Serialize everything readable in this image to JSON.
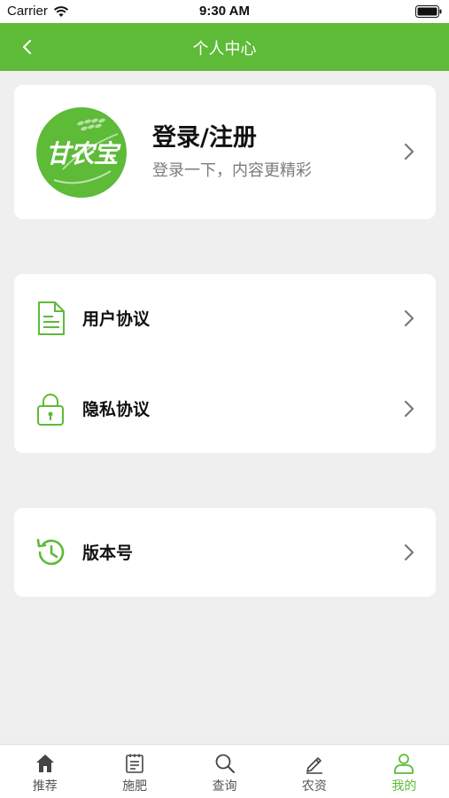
{
  "status_bar": {
    "carrier": "Carrier",
    "time": "9:30 AM"
  },
  "nav_bar": {
    "title": "个人中心"
  },
  "profile": {
    "logo_text": "甘农宝",
    "name": "登录/注册",
    "subtitle": "登录一下，内容更精彩"
  },
  "menu": {
    "user_agreement": "用户协议",
    "privacy_agreement": "隐私协议",
    "version": "版本号"
  },
  "tabs": [
    {
      "label": "推荐",
      "icon": "home-icon"
    },
    {
      "label": "施肥",
      "icon": "notepad-icon"
    },
    {
      "label": "查询",
      "icon": "search-icon"
    },
    {
      "label": "农资",
      "icon": "pencil-icon"
    },
    {
      "label": "我的",
      "icon": "user-icon",
      "active": true
    }
  ],
  "colors": {
    "accent": "#5dbb37",
    "background": "#efefef"
  }
}
